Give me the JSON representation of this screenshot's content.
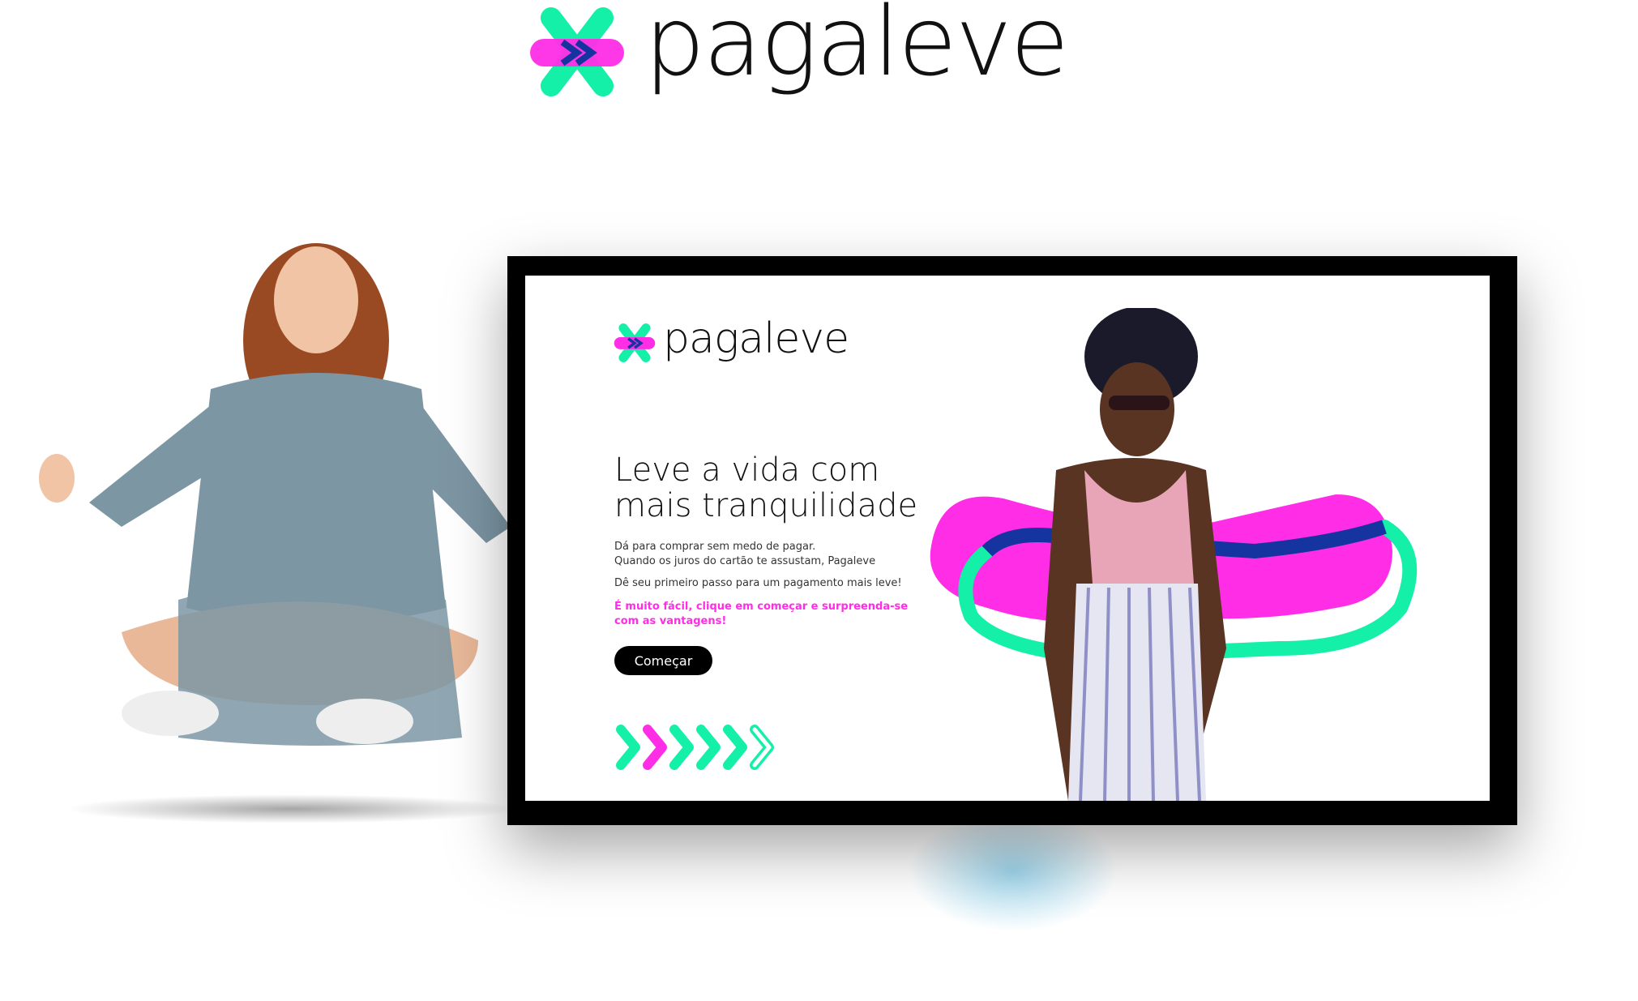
{
  "brand": {
    "name": "pagaleve",
    "colors": {
      "magenta": "#ff2de6",
      "green": "#14f0a8",
      "navy": "#1534a0",
      "black": "#000000"
    }
  },
  "screen": {
    "logo_text": "pagaleve",
    "heading_line1": "Leve a vida com",
    "heading_line2": "mais tranquilidade",
    "paragraph_line1": "Dá para comprar sem medo de pagar.",
    "paragraph_line2": "Quando os juros do cartão te assustam, Pagaleve",
    "paragraph_line3": "Dê seu primeiro passo para um pagamento mais leve!",
    "highlight_line1": "É muito fácil, clique em começar e surpreenda-se",
    "highlight_line2": "com as vantagens!",
    "cta_label": "Começar"
  }
}
